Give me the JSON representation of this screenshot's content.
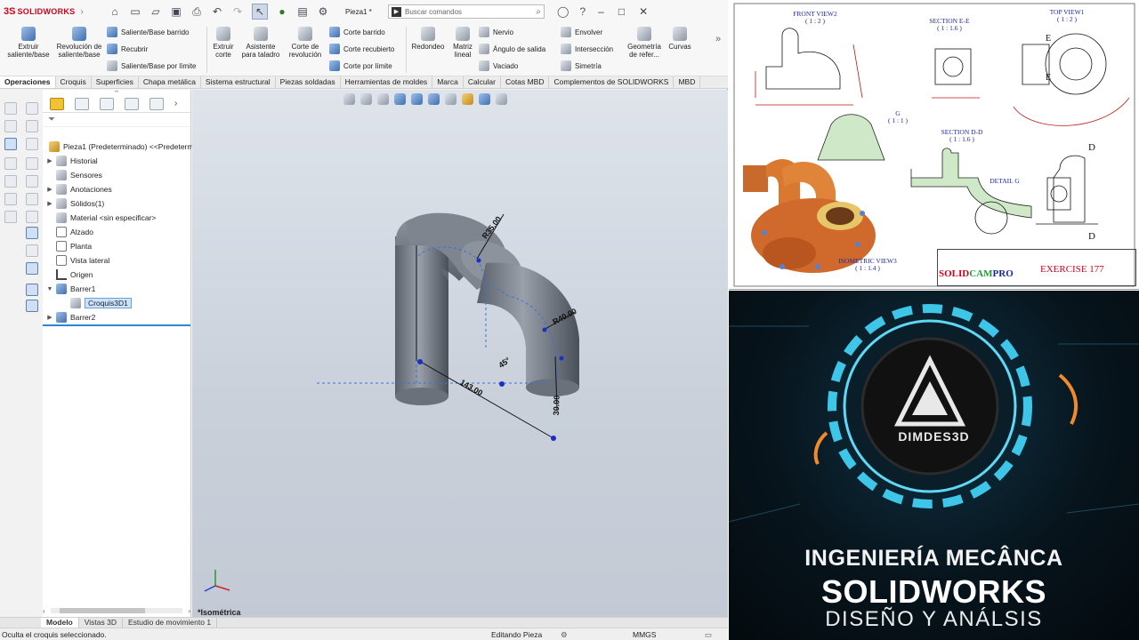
{
  "app": {
    "brand": "SOLIDWORKS",
    "brand_ds": "3S",
    "doc_name": "Pieza1 *",
    "search_placeholder": "Buscar comandos"
  },
  "ribbon": {
    "extrude_boss": "Extruir saliente/base",
    "revolve_boss": "Revolución de saliente/base",
    "swept_boss": "Saliente/Base barrido",
    "loft_boss": "Recubrir",
    "boundary_boss": "Saliente/Base por límite",
    "extrude_cut": "Extruir corte",
    "hole_wizard": "Asistente para taladro",
    "revolve_cut": "Corte de revolución",
    "swept_cut": "Corte barrido",
    "loft_cut": "Corte recubierto",
    "boundary_cut": "Corte por límite",
    "fillet": "Redondeo",
    "linear_pattern": "Matriz lineal",
    "rib": "Nervio",
    "draft": "Ángulo de salida",
    "shell": "Vaciado",
    "wrap": "Envolver",
    "intersect": "Intersección",
    "mirror": "Simetría",
    "ref_geometry": "Geometría de refer...",
    "curves": "Curvas"
  },
  "tabs": [
    "Operaciones",
    "Croquis",
    "Superficies",
    "Chapa metálica",
    "Sistema estructural",
    "Piezas soldadas",
    "Herramientas de moldes",
    "Marca",
    "Calcular",
    "Cotas MBD",
    "Complementos de SOLIDWORKS",
    "MBD"
  ],
  "tree": {
    "root": "Pieza1 (Predeterminado) <<Predeterm",
    "items": [
      "Historial",
      "Sensores",
      "Anotaciones",
      "Sólidos(1)",
      "Material <sin especificar>",
      "Alzado",
      "Planta",
      "Vista lateral",
      "Origen",
      "Barrer1",
      "Croquis3D1",
      "Barrer2"
    ]
  },
  "viewport": {
    "orientation": "*Isométrica",
    "dims": {
      "r35": "R35.00",
      "r40": "R40.00",
      "d143": "143.00",
      "a45": "45°",
      "d30": "30.00"
    }
  },
  "bottom_tabs": [
    "Modelo",
    "Vistas 3D",
    "Estudio de movimiento 1"
  ],
  "status": {
    "message": "Oculta el croquis seleccionado.",
    "mode": "Editando Pieza",
    "units": "MMGS"
  },
  "sheet": {
    "front_view": "FRONT VIEW2",
    "front_scale": "( 1 : 2 )",
    "section_ee": "SECTION E-E",
    "section_ee_scale": "( 1 : 1.6 )",
    "top_view": "TOP VIEW1",
    "top_scale": "( 1 : 2 )",
    "detail_g": "G",
    "detail_g_scale": "( 1 : 1 )",
    "section_dd": "SECTION D-D",
    "section_dd_scale": "( 1 : 1.6 )",
    "detail_label": "DETAIL G",
    "iso_view": "ISOMETRIC VIEW3",
    "iso_scale": "( 1 : 1.4 )",
    "brand_solid": "SOLID",
    "brand_cam": "CAM",
    "brand_pro": "PRO",
    "exercise": "EXERCISE 177",
    "label_e": "E",
    "label_d": "D"
  },
  "promo": {
    "logo_name": "DIMDES3D",
    "line1": "INGENIERÍA MECÂNCA",
    "line2": "SOLIDWORKS",
    "line3": "DISEÑO Y ANÁLSIS"
  }
}
